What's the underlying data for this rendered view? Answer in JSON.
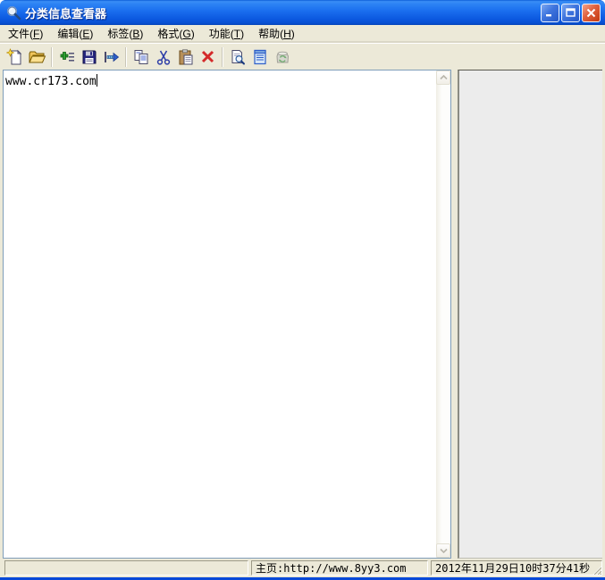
{
  "window": {
    "title": "分类信息查看器"
  },
  "menu": {
    "items": [
      {
        "pre": "文件(",
        "key": "F",
        "post": ")"
      },
      {
        "pre": "编辑(",
        "key": "E",
        "post": ")"
      },
      {
        "pre": "标签(",
        "key": "B",
        "post": ")"
      },
      {
        "pre": "格式(",
        "key": "G",
        "post": ")"
      },
      {
        "pre": "功能(",
        "key": "T",
        "post": ")"
      },
      {
        "pre": "帮助(",
        "key": "H",
        "post": ")"
      }
    ]
  },
  "toolbar": {
    "buttons": [
      "new",
      "open",
      "add-record",
      "save",
      "export",
      "copy",
      "cut",
      "paste",
      "delete",
      "print-preview",
      "view-document",
      "refresh"
    ]
  },
  "editor": {
    "text": "www.cr173.com"
  },
  "statusbar": {
    "left": "",
    "homepage": "主页:http://www.8yy3.com",
    "datetime": "2012年11月29日10时37分41秒"
  },
  "colors": {
    "titlebar_blue": "#1A6DEE",
    "chrome_beige": "#ECE9D8",
    "close_red": "#D9512E",
    "panel_gray": "#ECECEC",
    "textbox_border": "#7F9DB9"
  }
}
